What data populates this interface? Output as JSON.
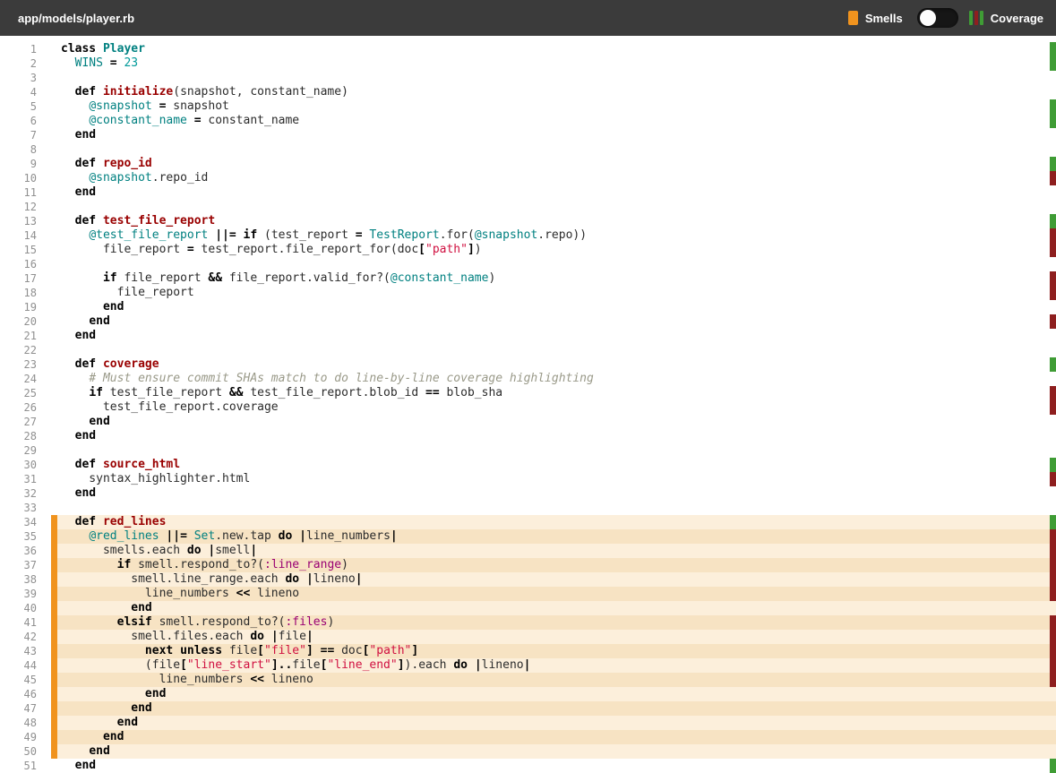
{
  "header": {
    "file_path": "app/models/player.rb",
    "smells_label": "Smells",
    "coverage_label": "Coverage",
    "toggle_state": "off"
  },
  "colors": {
    "header_bg": "#3b3b3b",
    "smell_accent": "#f0931e",
    "smell_bg_light": "#fcefdb",
    "smell_bg_dark": "#f7e3c3",
    "coverage_green": "#3f9c35",
    "coverage_red": "#8e1f1f",
    "keyword": "#000000",
    "method_name": "#990000",
    "constant_teal": "#008080",
    "string_red": "#d01040",
    "symbol": "#990073",
    "number": "#009999",
    "comment_gray": "#999988",
    "line_number_gray": "#909090"
  },
  "code": {
    "language": "ruby",
    "smell_region": {
      "start": 34,
      "end": 50
    },
    "coverage": [
      {
        "line": 1,
        "status": "covered"
      },
      {
        "line": 2,
        "status": "covered"
      },
      {
        "line": 5,
        "status": "covered"
      },
      {
        "line": 6,
        "status": "covered"
      },
      {
        "line": 9,
        "status": "covered"
      },
      {
        "line": 10,
        "status": "uncovered"
      },
      {
        "line": 13,
        "status": "covered"
      },
      {
        "line": 14,
        "status": "uncovered"
      },
      {
        "line": 15,
        "status": "uncovered"
      },
      {
        "line": 17,
        "status": "uncovered"
      },
      {
        "line": 18,
        "status": "uncovered"
      },
      {
        "line": 20,
        "status": "uncovered"
      },
      {
        "line": 23,
        "status": "covered"
      },
      {
        "line": 25,
        "status": "uncovered"
      },
      {
        "line": 26,
        "status": "uncovered"
      },
      {
        "line": 30,
        "status": "covered"
      },
      {
        "line": 31,
        "status": "uncovered"
      },
      {
        "line": 34,
        "status": "covered"
      },
      {
        "line": 35,
        "status": "uncovered"
      },
      {
        "line": 36,
        "status": "uncovered"
      },
      {
        "line": 37,
        "status": "uncovered"
      },
      {
        "line": 38,
        "status": "uncovered"
      },
      {
        "line": 39,
        "status": "uncovered"
      },
      {
        "line": 41,
        "status": "uncovered"
      },
      {
        "line": 42,
        "status": "uncovered"
      },
      {
        "line": 43,
        "status": "uncovered"
      },
      {
        "line": 44,
        "status": "uncovered"
      },
      {
        "line": 45,
        "status": "uncovered"
      },
      {
        "line": 51,
        "status": "covered"
      }
    ],
    "lines": [
      {
        "n": 1,
        "c": [
          [
            "k",
            "class"
          ],
          [
            "p",
            " "
          ],
          [
            "nc",
            "Player"
          ]
        ]
      },
      {
        "n": 2,
        "c": [
          [
            "p",
            "  "
          ],
          [
            "no",
            "WINS"
          ],
          [
            "p",
            " "
          ],
          [
            "o",
            "="
          ],
          [
            "p",
            " "
          ],
          [
            "mi",
            "23"
          ]
        ]
      },
      {
        "n": 3,
        "c": []
      },
      {
        "n": 4,
        "c": [
          [
            "p",
            "  "
          ],
          [
            "k",
            "def"
          ],
          [
            "p",
            " "
          ],
          [
            "nf",
            "initialize"
          ],
          [
            "p",
            "(snapshot, constant_name)"
          ]
        ]
      },
      {
        "n": 5,
        "c": [
          [
            "p",
            "    "
          ],
          [
            "vi",
            "@snapshot"
          ],
          [
            "p",
            " "
          ],
          [
            "o",
            "="
          ],
          [
            "p",
            " snapshot"
          ]
        ]
      },
      {
        "n": 6,
        "c": [
          [
            "p",
            "    "
          ],
          [
            "vi",
            "@constant_name"
          ],
          [
            "p",
            " "
          ],
          [
            "o",
            "="
          ],
          [
            "p",
            " constant_name"
          ]
        ]
      },
      {
        "n": 7,
        "c": [
          [
            "p",
            "  "
          ],
          [
            "k",
            "end"
          ]
        ]
      },
      {
        "n": 8,
        "c": []
      },
      {
        "n": 9,
        "c": [
          [
            "p",
            "  "
          ],
          [
            "k",
            "def"
          ],
          [
            "p",
            " "
          ],
          [
            "nf",
            "repo_id"
          ]
        ]
      },
      {
        "n": 10,
        "c": [
          [
            "p",
            "    "
          ],
          [
            "vi",
            "@snapshot"
          ],
          [
            "p",
            ".repo_id"
          ]
        ]
      },
      {
        "n": 11,
        "c": [
          [
            "p",
            "  "
          ],
          [
            "k",
            "end"
          ]
        ]
      },
      {
        "n": 12,
        "c": []
      },
      {
        "n": 13,
        "c": [
          [
            "p",
            "  "
          ],
          [
            "k",
            "def"
          ],
          [
            "p",
            " "
          ],
          [
            "nf",
            "test_file_report"
          ]
        ]
      },
      {
        "n": 14,
        "c": [
          [
            "p",
            "    "
          ],
          [
            "vi",
            "@test_file_report"
          ],
          [
            "p",
            " "
          ],
          [
            "o",
            "||="
          ],
          [
            "p",
            " "
          ],
          [
            "k",
            "if"
          ],
          [
            "p",
            " (test_report "
          ],
          [
            "o",
            "="
          ],
          [
            "p",
            " "
          ],
          [
            "no",
            "TestReport"
          ],
          [
            "p",
            ".for("
          ],
          [
            "vi",
            "@snapshot"
          ],
          [
            "p",
            ".repo))"
          ]
        ]
      },
      {
        "n": 15,
        "c": [
          [
            "p",
            "      file_report "
          ],
          [
            "o",
            "="
          ],
          [
            "p",
            " test_report.file_report_for(doc"
          ],
          [
            "o",
            "["
          ],
          [
            "s",
            "\"path\""
          ],
          [
            "o",
            "]"
          ],
          [
            "p",
            ")"
          ]
        ]
      },
      {
        "n": 16,
        "c": []
      },
      {
        "n": 17,
        "c": [
          [
            "p",
            "      "
          ],
          [
            "k",
            "if"
          ],
          [
            "p",
            " file_report "
          ],
          [
            "o",
            "&&"
          ],
          [
            "p",
            " file_report.valid_for?("
          ],
          [
            "vi",
            "@constant_name"
          ],
          [
            "p",
            ")"
          ]
        ]
      },
      {
        "n": 18,
        "c": [
          [
            "p",
            "        file_report"
          ]
        ]
      },
      {
        "n": 19,
        "c": [
          [
            "p",
            "      "
          ],
          [
            "k",
            "end"
          ]
        ]
      },
      {
        "n": 20,
        "c": [
          [
            "p",
            "    "
          ],
          [
            "k",
            "end"
          ]
        ]
      },
      {
        "n": 21,
        "c": [
          [
            "p",
            "  "
          ],
          [
            "k",
            "end"
          ]
        ]
      },
      {
        "n": 22,
        "c": []
      },
      {
        "n": 23,
        "c": [
          [
            "p",
            "  "
          ],
          [
            "k",
            "def"
          ],
          [
            "p",
            " "
          ],
          [
            "nf",
            "coverage"
          ]
        ]
      },
      {
        "n": 24,
        "c": [
          [
            "p",
            "    "
          ],
          [
            "c",
            "# Must ensure commit SHAs match to do line-by-line coverage highlighting"
          ]
        ]
      },
      {
        "n": 25,
        "c": [
          [
            "p",
            "    "
          ],
          [
            "k",
            "if"
          ],
          [
            "p",
            " test_file_report "
          ],
          [
            "o",
            "&&"
          ],
          [
            "p",
            " test_file_report.blob_id "
          ],
          [
            "o",
            "=="
          ],
          [
            "p",
            " blob_sha"
          ]
        ]
      },
      {
        "n": 26,
        "c": [
          [
            "p",
            "      test_file_report.coverage"
          ]
        ]
      },
      {
        "n": 27,
        "c": [
          [
            "p",
            "    "
          ],
          [
            "k",
            "end"
          ]
        ]
      },
      {
        "n": 28,
        "c": [
          [
            "p",
            "  "
          ],
          [
            "k",
            "end"
          ]
        ]
      },
      {
        "n": 29,
        "c": []
      },
      {
        "n": 30,
        "c": [
          [
            "p",
            "  "
          ],
          [
            "k",
            "def"
          ],
          [
            "p",
            " "
          ],
          [
            "nf",
            "source_html"
          ]
        ]
      },
      {
        "n": 31,
        "c": [
          [
            "p",
            "    syntax_highlighter.html"
          ]
        ]
      },
      {
        "n": 32,
        "c": [
          [
            "p",
            "  "
          ],
          [
            "k",
            "end"
          ]
        ]
      },
      {
        "n": 33,
        "c": []
      },
      {
        "n": 34,
        "c": [
          [
            "p",
            "  "
          ],
          [
            "k",
            "def"
          ],
          [
            "p",
            " "
          ],
          [
            "nf",
            "red_lines"
          ]
        ]
      },
      {
        "n": 35,
        "c": [
          [
            "p",
            "    "
          ],
          [
            "vi",
            "@red_lines"
          ],
          [
            "p",
            " "
          ],
          [
            "o",
            "||="
          ],
          [
            "p",
            " "
          ],
          [
            "no",
            "Set"
          ],
          [
            "p",
            ".new.tap "
          ],
          [
            "k",
            "do"
          ],
          [
            "p",
            " "
          ],
          [
            "o",
            "|"
          ],
          [
            "p",
            "line_numbers"
          ],
          [
            "o",
            "|"
          ]
        ]
      },
      {
        "n": 36,
        "c": [
          [
            "p",
            "      smells.each "
          ],
          [
            "k",
            "do"
          ],
          [
            "p",
            " "
          ],
          [
            "o",
            "|"
          ],
          [
            "p",
            "smell"
          ],
          [
            "o",
            "|"
          ]
        ]
      },
      {
        "n": 37,
        "c": [
          [
            "p",
            "        "
          ],
          [
            "k",
            "if"
          ],
          [
            "p",
            " smell.respond_to?("
          ],
          [
            "ss",
            ":line_range"
          ],
          [
            "p",
            ")"
          ]
        ]
      },
      {
        "n": 38,
        "c": [
          [
            "p",
            "          smell.line_range.each "
          ],
          [
            "k",
            "do"
          ],
          [
            "p",
            " "
          ],
          [
            "o",
            "|"
          ],
          [
            "p",
            "lineno"
          ],
          [
            "o",
            "|"
          ]
        ]
      },
      {
        "n": 39,
        "c": [
          [
            "p",
            "            line_numbers "
          ],
          [
            "o",
            "<<"
          ],
          [
            "p",
            " lineno"
          ]
        ]
      },
      {
        "n": 40,
        "c": [
          [
            "p",
            "          "
          ],
          [
            "k",
            "end"
          ]
        ]
      },
      {
        "n": 41,
        "c": [
          [
            "p",
            "        "
          ],
          [
            "k",
            "elsif"
          ],
          [
            "p",
            " smell.respond_to?("
          ],
          [
            "ss",
            ":files"
          ],
          [
            "p",
            ")"
          ]
        ]
      },
      {
        "n": 42,
        "c": [
          [
            "p",
            "          smell.files.each "
          ],
          [
            "k",
            "do"
          ],
          [
            "p",
            " "
          ],
          [
            "o",
            "|"
          ],
          [
            "p",
            "file"
          ],
          [
            "o",
            "|"
          ]
        ]
      },
      {
        "n": 43,
        "c": [
          [
            "p",
            "            "
          ],
          [
            "k",
            "next"
          ],
          [
            "p",
            " "
          ],
          [
            "k",
            "unless"
          ],
          [
            "p",
            " file"
          ],
          [
            "o",
            "["
          ],
          [
            "s",
            "\"file\""
          ],
          [
            "o",
            "]"
          ],
          [
            "p",
            " "
          ],
          [
            "o",
            "=="
          ],
          [
            "p",
            " doc"
          ],
          [
            "o",
            "["
          ],
          [
            "s",
            "\"path\""
          ],
          [
            "o",
            "]"
          ]
        ]
      },
      {
        "n": 44,
        "c": [
          [
            "p",
            "            (file"
          ],
          [
            "o",
            "["
          ],
          [
            "s",
            "\"line_start\""
          ],
          [
            "o",
            "]"
          ],
          [
            "o",
            ".."
          ],
          [
            "p",
            "file"
          ],
          [
            "o",
            "["
          ],
          [
            "s",
            "\"line_end\""
          ],
          [
            "o",
            "]"
          ],
          [
            "p",
            ").each "
          ],
          [
            "k",
            "do"
          ],
          [
            "p",
            " "
          ],
          [
            "o",
            "|"
          ],
          [
            "p",
            "lineno"
          ],
          [
            "o",
            "|"
          ]
        ]
      },
      {
        "n": 45,
        "c": [
          [
            "p",
            "              line_numbers "
          ],
          [
            "o",
            "<<"
          ],
          [
            "p",
            " lineno"
          ]
        ]
      },
      {
        "n": 46,
        "c": [
          [
            "p",
            "            "
          ],
          [
            "k",
            "end"
          ]
        ]
      },
      {
        "n": 47,
        "c": [
          [
            "p",
            "          "
          ],
          [
            "k",
            "end"
          ]
        ]
      },
      {
        "n": 48,
        "c": [
          [
            "p",
            "        "
          ],
          [
            "k",
            "end"
          ]
        ]
      },
      {
        "n": 49,
        "c": [
          [
            "p",
            "      "
          ],
          [
            "k",
            "end"
          ]
        ]
      },
      {
        "n": 50,
        "c": [
          [
            "p",
            "    "
          ],
          [
            "k",
            "end"
          ]
        ]
      },
      {
        "n": 51,
        "c": [
          [
            "p",
            "  "
          ],
          [
            "k",
            "end"
          ]
        ]
      }
    ]
  }
}
